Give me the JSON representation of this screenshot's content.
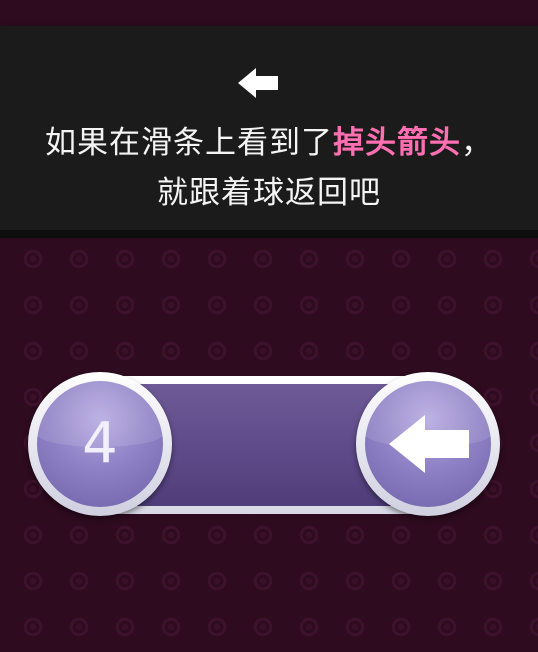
{
  "tutorial": {
    "line1_prefix": "如果在滑条上看到了",
    "line1_highlight": "掉头箭头",
    "line1_suffix": "，",
    "line2": "就跟着球返回吧",
    "arrow_icon": "left-arrow-icon"
  },
  "slider": {
    "ball_number": "4",
    "end_icon": "u-turn-left-arrow-icon"
  },
  "colors": {
    "background": "#2e0b1f",
    "banner": "#1b1b1b",
    "highlight": "#ff6fb2",
    "knob": "#8f82c6",
    "track": "#5e4a88"
  }
}
